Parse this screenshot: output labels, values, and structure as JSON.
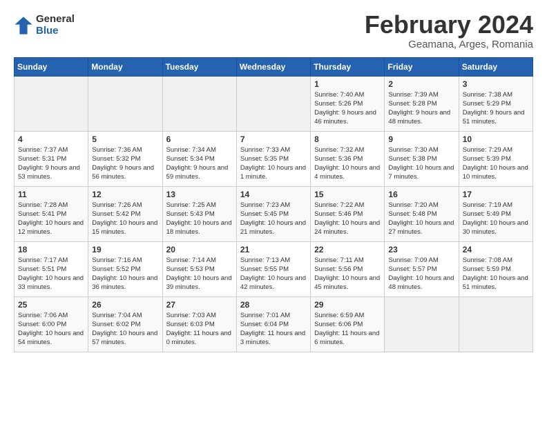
{
  "header": {
    "logo_general": "General",
    "logo_blue": "Blue",
    "month_title": "February 2024",
    "location": "Geamana, Arges, Romania"
  },
  "days_of_week": [
    "Sunday",
    "Monday",
    "Tuesday",
    "Wednesday",
    "Thursday",
    "Friday",
    "Saturday"
  ],
  "weeks": [
    [
      {
        "day": "",
        "empty": true
      },
      {
        "day": "",
        "empty": true
      },
      {
        "day": "",
        "empty": true
      },
      {
        "day": "",
        "empty": true
      },
      {
        "day": "1",
        "sunrise": "7:40 AM",
        "sunset": "5:26 PM",
        "daylight": "9 hours and 46 minutes."
      },
      {
        "day": "2",
        "sunrise": "7:39 AM",
        "sunset": "5:28 PM",
        "daylight": "9 hours and 48 minutes."
      },
      {
        "day": "3",
        "sunrise": "7:38 AM",
        "sunset": "5:29 PM",
        "daylight": "9 hours and 51 minutes."
      }
    ],
    [
      {
        "day": "4",
        "sunrise": "7:37 AM",
        "sunset": "5:31 PM",
        "daylight": "9 hours and 53 minutes."
      },
      {
        "day": "5",
        "sunrise": "7:36 AM",
        "sunset": "5:32 PM",
        "daylight": "9 hours and 56 minutes."
      },
      {
        "day": "6",
        "sunrise": "7:34 AM",
        "sunset": "5:34 PM",
        "daylight": "9 hours and 59 minutes."
      },
      {
        "day": "7",
        "sunrise": "7:33 AM",
        "sunset": "5:35 PM",
        "daylight": "10 hours and 1 minute."
      },
      {
        "day": "8",
        "sunrise": "7:32 AM",
        "sunset": "5:36 PM",
        "daylight": "10 hours and 4 minutes."
      },
      {
        "day": "9",
        "sunrise": "7:30 AM",
        "sunset": "5:38 PM",
        "daylight": "10 hours and 7 minutes."
      },
      {
        "day": "10",
        "sunrise": "7:29 AM",
        "sunset": "5:39 PM",
        "daylight": "10 hours and 10 minutes."
      }
    ],
    [
      {
        "day": "11",
        "sunrise": "7:28 AM",
        "sunset": "5:41 PM",
        "daylight": "10 hours and 12 minutes."
      },
      {
        "day": "12",
        "sunrise": "7:26 AM",
        "sunset": "5:42 PM",
        "daylight": "10 hours and 15 minutes."
      },
      {
        "day": "13",
        "sunrise": "7:25 AM",
        "sunset": "5:43 PM",
        "daylight": "10 hours and 18 minutes."
      },
      {
        "day": "14",
        "sunrise": "7:23 AM",
        "sunset": "5:45 PM",
        "daylight": "10 hours and 21 minutes."
      },
      {
        "day": "15",
        "sunrise": "7:22 AM",
        "sunset": "5:46 PM",
        "daylight": "10 hours and 24 minutes."
      },
      {
        "day": "16",
        "sunrise": "7:20 AM",
        "sunset": "5:48 PM",
        "daylight": "10 hours and 27 minutes."
      },
      {
        "day": "17",
        "sunrise": "7:19 AM",
        "sunset": "5:49 PM",
        "daylight": "10 hours and 30 minutes."
      }
    ],
    [
      {
        "day": "18",
        "sunrise": "7:17 AM",
        "sunset": "5:51 PM",
        "daylight": "10 hours and 33 minutes."
      },
      {
        "day": "19",
        "sunrise": "7:16 AM",
        "sunset": "5:52 PM",
        "daylight": "10 hours and 36 minutes."
      },
      {
        "day": "20",
        "sunrise": "7:14 AM",
        "sunset": "5:53 PM",
        "daylight": "10 hours and 39 minutes."
      },
      {
        "day": "21",
        "sunrise": "7:13 AM",
        "sunset": "5:55 PM",
        "daylight": "10 hours and 42 minutes."
      },
      {
        "day": "22",
        "sunrise": "7:11 AM",
        "sunset": "5:56 PM",
        "daylight": "10 hours and 45 minutes."
      },
      {
        "day": "23",
        "sunrise": "7:09 AM",
        "sunset": "5:57 PM",
        "daylight": "10 hours and 48 minutes."
      },
      {
        "day": "24",
        "sunrise": "7:08 AM",
        "sunset": "5:59 PM",
        "daylight": "10 hours and 51 minutes."
      }
    ],
    [
      {
        "day": "25",
        "sunrise": "7:06 AM",
        "sunset": "6:00 PM",
        "daylight": "10 hours and 54 minutes."
      },
      {
        "day": "26",
        "sunrise": "7:04 AM",
        "sunset": "6:02 PM",
        "daylight": "10 hours and 57 minutes."
      },
      {
        "day": "27",
        "sunrise": "7:03 AM",
        "sunset": "6:03 PM",
        "daylight": "11 hours and 0 minutes."
      },
      {
        "day": "28",
        "sunrise": "7:01 AM",
        "sunset": "6:04 PM",
        "daylight": "11 hours and 3 minutes."
      },
      {
        "day": "29",
        "sunrise": "6:59 AM",
        "sunset": "6:06 PM",
        "daylight": "11 hours and 6 minutes."
      },
      {
        "day": "",
        "empty": true
      },
      {
        "day": "",
        "empty": true
      }
    ]
  ]
}
